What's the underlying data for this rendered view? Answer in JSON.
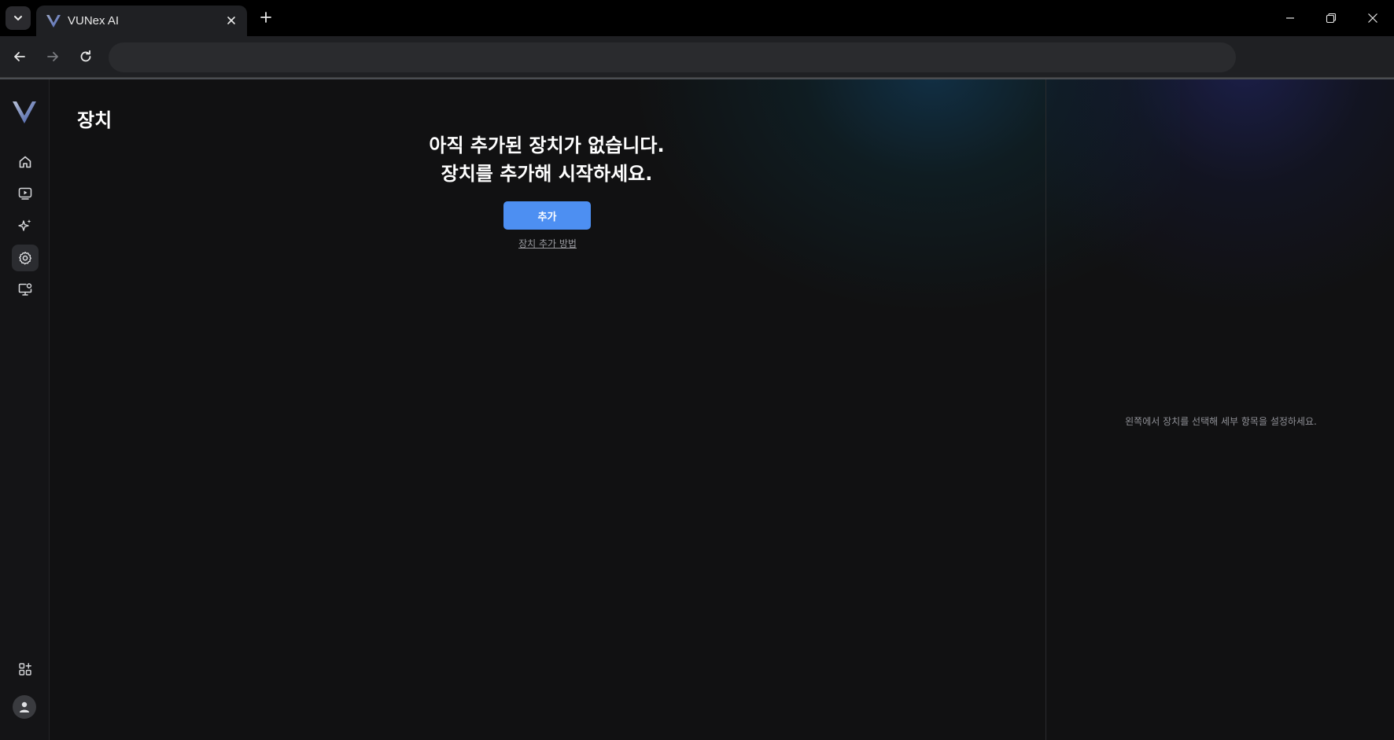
{
  "browser": {
    "tab_title": "VUNex AI",
    "address": ""
  },
  "sidebar": {
    "items": [
      {
        "icon": "home-icon"
      },
      {
        "icon": "video-icon"
      },
      {
        "icon": "sparkle-icon"
      },
      {
        "icon": "settings-icon",
        "active": true
      },
      {
        "icon": "monitor-settings-icon"
      }
    ],
    "bottom": [
      {
        "icon": "apps-add-icon"
      },
      {
        "icon": "user-icon"
      }
    ]
  },
  "main": {
    "title": "장치",
    "empty_line1": "아직 추가된 장치가 없습니다.",
    "empty_line2": "장치를 추가해 시작하세요.",
    "add_button": "추가",
    "help_link": "장치 추가 방법"
  },
  "detail": {
    "hint": "왼쪽에서 장치를 선택해 세부 항목을 설정하세요."
  },
  "colors": {
    "accent": "#4d8ff2",
    "background": "#111112",
    "sidebar": "#141416"
  }
}
